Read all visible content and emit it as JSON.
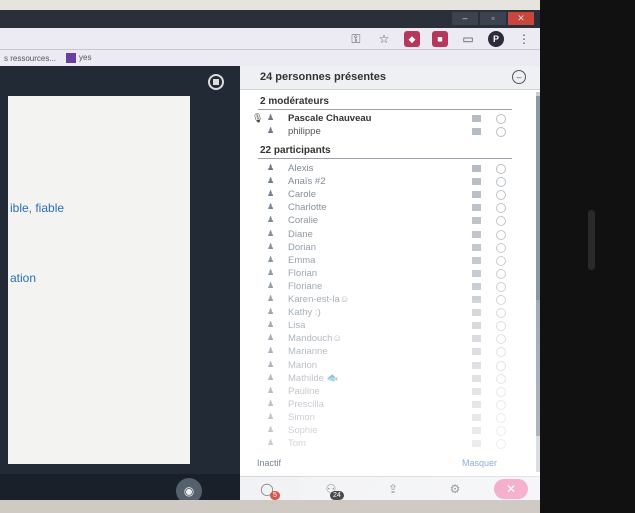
{
  "browser": {
    "bookmarks": [
      {
        "label": "s ressources..."
      },
      {
        "label": "yes"
      }
    ],
    "toolbar_icons": [
      "key-icon",
      "star-icon",
      "extension-icon",
      "extension-icon",
      "cast-icon",
      "profile-icon",
      "menu-icon"
    ],
    "profile_initial": "P"
  },
  "stage": {
    "slide_lines": [
      "ible, fiable",
      "ation"
    ]
  },
  "sidebar": {
    "title": "24 personnes présentes",
    "moderators_heading": "2 modérateurs",
    "moderators": [
      {
        "name": "Pascale Chauveau",
        "mic": true
      },
      {
        "name": "philippe",
        "mic": false
      }
    ],
    "participants_heading": "22 participants",
    "participants": [
      {
        "name": "Alexis"
      },
      {
        "name": "Anaïs #2"
      },
      {
        "name": "Carole"
      },
      {
        "name": "Charlotte"
      },
      {
        "name": "Coralie"
      },
      {
        "name": "Diane"
      },
      {
        "name": "Dorian"
      },
      {
        "name": "Emma"
      },
      {
        "name": "Florian"
      },
      {
        "name": "Floriane"
      },
      {
        "name": "Karen-est-la☺"
      },
      {
        "name": "Kathy :)"
      },
      {
        "name": "Lisa"
      },
      {
        "name": "Mandouch☺"
      },
      {
        "name": "Marianne"
      },
      {
        "name": "Marion"
      },
      {
        "name": "Mathilde 🐟"
      },
      {
        "name": "Pauline"
      },
      {
        "name": "Prescilla"
      },
      {
        "name": "Simon"
      },
      {
        "name": "Sophie"
      },
      {
        "name": "Tom"
      }
    ],
    "inactive_label": "Inactif",
    "inactive_link": "Masquer",
    "footer": {
      "chat_badge": "5",
      "participants_badge": "24"
    }
  },
  "colors": {
    "stage_bg": "#222a35",
    "accent_link": "#2b6fb3",
    "leave_button": "#f08cb8"
  }
}
